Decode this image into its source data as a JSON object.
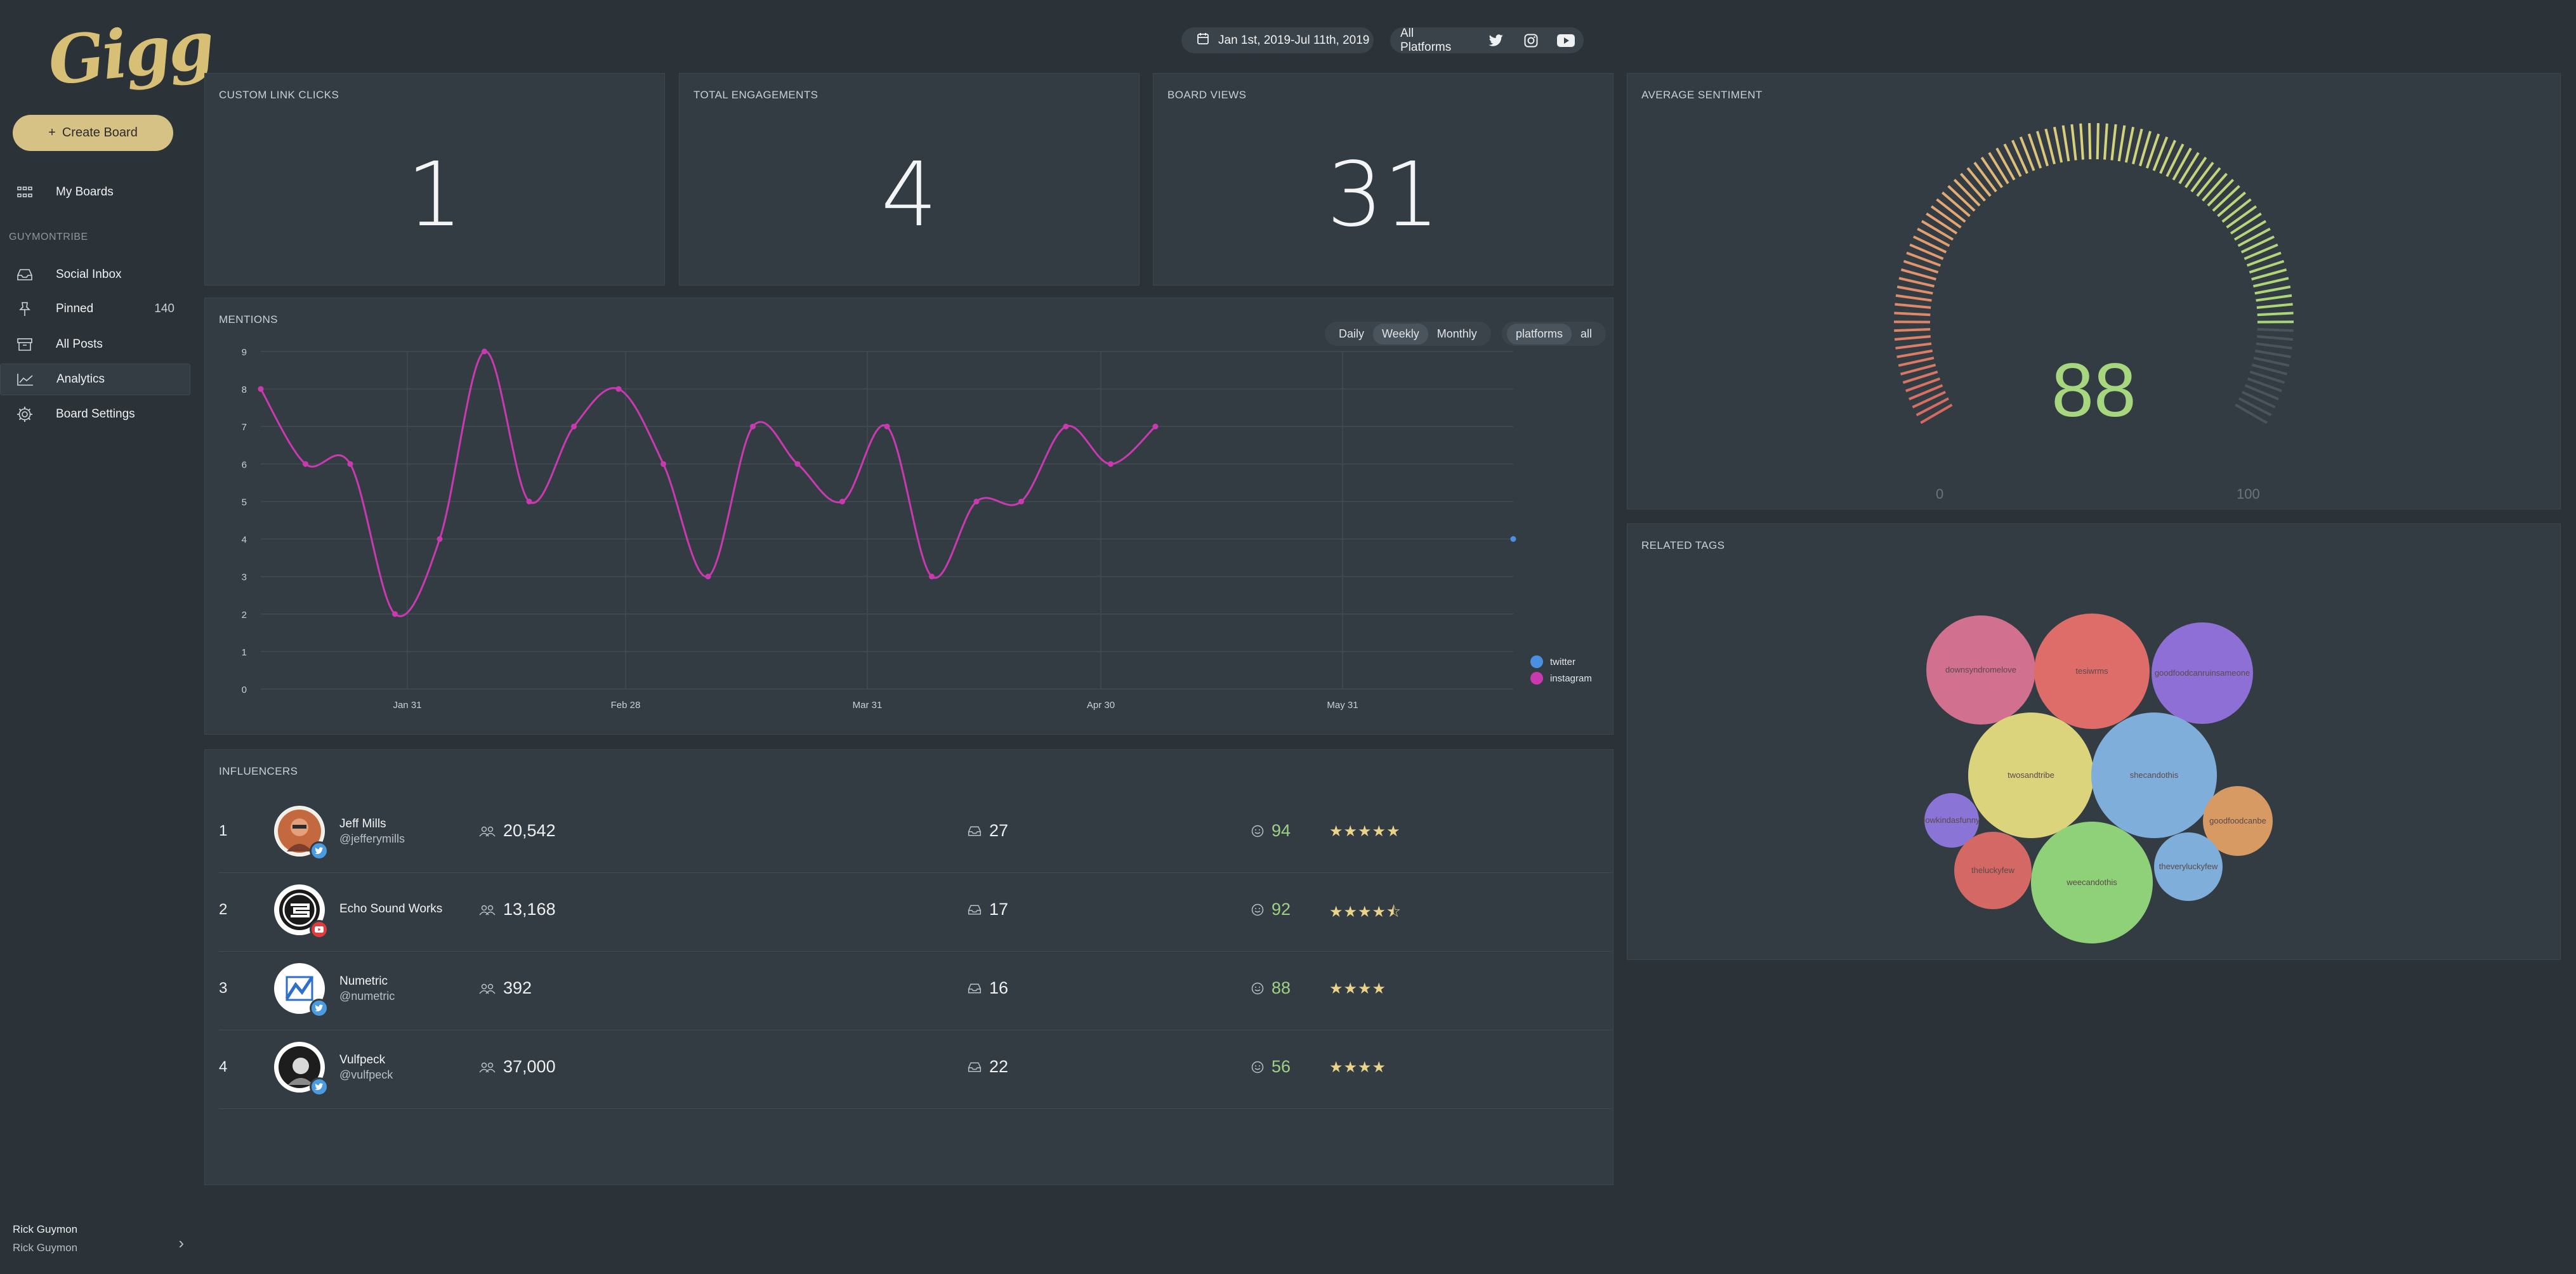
{
  "sidebar": {
    "logo": "Gigg",
    "create_label": "Create Board",
    "my_boards": "My Boards",
    "group": "GUYMONTRIBE",
    "items": [
      {
        "label": "Social Inbox",
        "count": ""
      },
      {
        "label": "Pinned",
        "count": "140"
      },
      {
        "label": "All Posts",
        "count": ""
      },
      {
        "label": "Analytics",
        "count": ""
      },
      {
        "label": "Board Settings",
        "count": ""
      }
    ],
    "user": {
      "name": "Rick Guymon",
      "sub": "Rick Guymon"
    }
  },
  "filters": {
    "date_range": "Jan 1st, 2019-Jul 11th, 2019",
    "platforms": "All Platforms"
  },
  "stats": [
    {
      "title": "CUSTOM LINK CLICKS",
      "value": "1"
    },
    {
      "title": "TOTAL ENGAGEMENTS",
      "value": "4"
    },
    {
      "title": "BOARD VIEWS",
      "value": "31"
    }
  ],
  "mentions": {
    "title": "MENTIONS",
    "periods": [
      "Daily",
      "Weekly",
      "Monthly"
    ],
    "active_period": "Weekly",
    "group_by": [
      "platforms",
      "all"
    ],
    "active_group": "platforms"
  },
  "chart_data": {
    "type": "line",
    "title": "MENTIONS",
    "ylim": [
      0,
      9
    ],
    "yticks": [
      "0",
      "1",
      "2",
      "3",
      "4",
      "5",
      "6",
      "7",
      "8",
      "9"
    ],
    "xticks": [
      "Jan 31",
      "Feb 28",
      "Mar 31",
      "Apr 30",
      "May 31"
    ],
    "legend_position": "right",
    "series": [
      {
        "name": "twitter",
        "color": "#4a90e2",
        "values": [
          null,
          null,
          null,
          null,
          null,
          null,
          null,
          null,
          null,
          null,
          null,
          null,
          null,
          null,
          null,
          null,
          null,
          null,
          null,
          null,
          null,
          null,
          null,
          null,
          null,
          null,
          null,
          null,
          4
        ]
      },
      {
        "name": "instagram",
        "color": "#c93ab0",
        "values": [
          8,
          6,
          6,
          2,
          4,
          9,
          5,
          7,
          8,
          6,
          3,
          7,
          6,
          5,
          7,
          3,
          5,
          5,
          7,
          6,
          7
        ]
      }
    ]
  },
  "sentiment": {
    "title": "AVERAGE SENTIMENT",
    "value": "88",
    "min": "0",
    "max": "100",
    "fraction": 0.88
  },
  "tags": {
    "title": "RELATED TAGS",
    "bubbles": [
      "downsyndromelove",
      "tesiwrms",
      "goodfoodcanruinsameone",
      "twosandtribe",
      "shecandothis",
      "goodfoodcanbe",
      "lowkindasfunny",
      "theluckyfew",
      "weecandothis",
      "theveryluckyfew"
    ]
  },
  "influencers": {
    "title": "INFLUENCERS",
    "rows": [
      {
        "rank": "1",
        "name": "Jeff Mills",
        "handle": "@jefferymills",
        "followers": "20,542",
        "posts": "27",
        "sentiment": "94",
        "stars": "★★★★★",
        "platform": "twitter"
      },
      {
        "rank": "2",
        "name": "Echo Sound Works",
        "handle": "",
        "followers": "13,168",
        "posts": "17",
        "sentiment": "92",
        "stars": "★★★★⯪",
        "platform": "youtube"
      },
      {
        "rank": "3",
        "name": "Numetric",
        "handle": "@numetric",
        "followers": "392",
        "posts": "16",
        "sentiment": "88",
        "stars": "★★★★",
        "platform": "twitter"
      },
      {
        "rank": "4",
        "name": "Vulfpeck",
        "handle": "@vulfpeck",
        "followers": "37,000",
        "posts": "22",
        "sentiment": "56",
        "stars": "★★★★",
        "platform": "twitter"
      }
    ]
  }
}
